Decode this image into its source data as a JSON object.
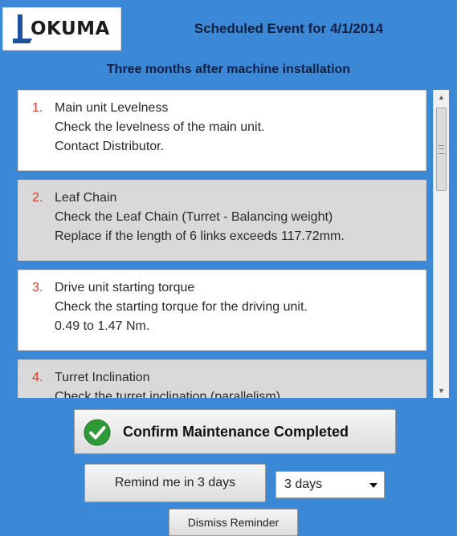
{
  "logo": {
    "text": "OKUMA"
  },
  "header": {
    "title": "Scheduled Event for 4/1/2014",
    "subtitle": "Three months after machine installation"
  },
  "tasks": [
    {
      "number": "1.",
      "title": "Main unit Levelness",
      "lines": [
        "Check the levelness of the main unit.",
        "Contact Distributor."
      ]
    },
    {
      "number": "2.",
      "title": "Leaf Chain",
      "lines": [
        "Check the Leaf Chain (Turret - Balancing weight)",
        "Replace if the length of 6 links exceeds 117.72mm."
      ]
    },
    {
      "number": "3.",
      "title": "Drive unit starting torque",
      "lines": [
        "Check the starting torque for the driving unit.",
        "0.49 to 1.47 Nm."
      ]
    },
    {
      "number": "4.",
      "title": "Turret Inclination",
      "lines": [
        "Check the turret inclination (parallelism).",
        ""
      ]
    }
  ],
  "buttons": {
    "confirm": "Confirm Maintenance Completed",
    "remind": "Remind me in 3 days",
    "dismiss": "Dismiss Reminder"
  },
  "remind_select": {
    "value": "3 days"
  },
  "colors": {
    "background": "#3b89d6",
    "item_number": "#d43b2b",
    "check_green": "#2e9b38"
  }
}
